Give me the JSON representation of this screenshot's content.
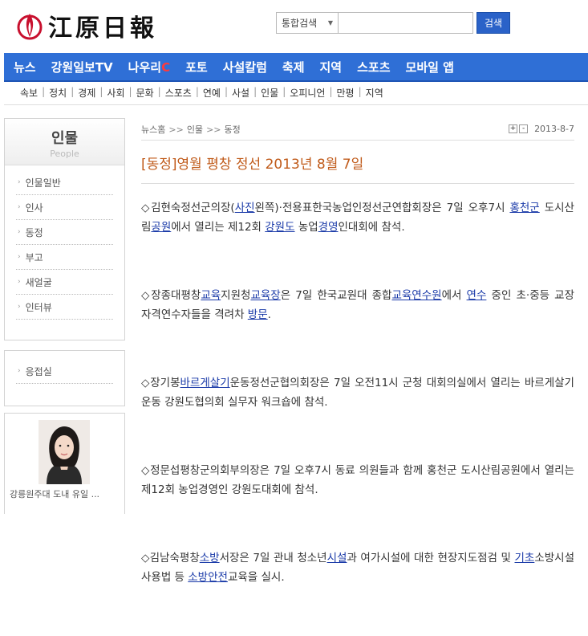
{
  "header": {
    "logo_text": "江原日報",
    "search": {
      "select_label": "통합검색",
      "input_value": "",
      "button_label": "검색"
    }
  },
  "main_nav": [
    {
      "label": "뉴스"
    },
    {
      "label": "강원일보TV"
    },
    {
      "label": "나우리",
      "accent": "C"
    },
    {
      "label": "포토"
    },
    {
      "label": "사설칼럼"
    },
    {
      "label": "축제"
    },
    {
      "label": "지역"
    },
    {
      "label": "스포츠"
    },
    {
      "label": "모바일 앱"
    }
  ],
  "sub_nav": [
    "속보",
    "정치",
    "경제",
    "사회",
    "문화",
    "스포츠",
    "연예",
    "사설",
    "인물",
    "오피니언",
    "만평",
    "지역"
  ],
  "sidebar": {
    "title": "인물",
    "subtitle": "People",
    "items": [
      "인물일반",
      "인사",
      "동정",
      "부고",
      "새얼굴",
      "인터뷰"
    ],
    "box2_items": [
      "응접실"
    ],
    "reporter_caption": "강릉원주대 도내 유일 ..."
  },
  "article": {
    "breadcrumb": [
      "뉴스홈",
      "인물",
      "동정"
    ],
    "breadcrumb_sep": ">>",
    "zoom_in": "+",
    "zoom_out": "-",
    "date": "2013-8-7",
    "title": "[동정]영월 평창 정선 2013년 8월 7일",
    "paragraphs": [
      [
        {
          "t": "◇김현숙정선군의장("
        },
        {
          "t": "사진",
          "link": true
        },
        {
          "t": "왼쪽)·전용표한국농업인정선군연합회장은 7일 오후7시 "
        },
        {
          "t": "홍천군",
          "link": true
        },
        {
          "t": " 도시산림"
        },
        {
          "t": "공원",
          "link": true
        },
        {
          "t": "에서 열리는 제12회 "
        },
        {
          "t": "강원도",
          "link": true
        },
        {
          "t": " 농업"
        },
        {
          "t": "경영",
          "link": true
        },
        {
          "t": "인대회에 참석."
        }
      ],
      [
        {
          "t": "◇장종대평창"
        },
        {
          "t": "교육",
          "link": true
        },
        {
          "t": "지원청"
        },
        {
          "t": "교육장",
          "link": true
        },
        {
          "t": "은 7일 한국교원대 종합"
        },
        {
          "t": "교육연수원",
          "link": true
        },
        {
          "t": "에서 "
        },
        {
          "t": "연수",
          "link": true
        },
        {
          "t": " 중인 초·중등 교장 자격연수자들을 격려차 "
        },
        {
          "t": "방문",
          "link": true
        },
        {
          "t": "."
        }
      ],
      [
        {
          "t": "◇장기봉"
        },
        {
          "t": "바르게살기",
          "link": true
        },
        {
          "t": "운동정선군협의회장은 7일 오전11시 군청 대회의실에서 열리는 바르게살기운동 강원도협의회 실무자 워크숍에 참석."
        }
      ],
      [
        {
          "t": "◇정문섭평창군의회부의장은 7일 오후7시 동료 의원들과 함께 홍천군 도시산림공원에서 열리는 제12회 농업경영인 강원도대회에 참석."
        }
      ],
      [
        {
          "t": "◇김남숙평창"
        },
        {
          "t": "소방",
          "link": true
        },
        {
          "t": "서장은 7일 관내 청소년"
        },
        {
          "t": "시설",
          "link": true
        },
        {
          "t": "과 여가시설에 대한 현장지도점검 및 "
        },
        {
          "t": "기초",
          "link": true
        },
        {
          "t": "소방시설 사용법 등 "
        },
        {
          "t": "소방안전",
          "link": true
        },
        {
          "t": "교육을 실시."
        }
      ]
    ]
  },
  "colors": {
    "nav_bg": "#2f6fd6",
    "accent_red": "#ff3a3a",
    "title": "#c05a19",
    "link": "#1a3aa8",
    "search_button": "#2a62c8"
  }
}
